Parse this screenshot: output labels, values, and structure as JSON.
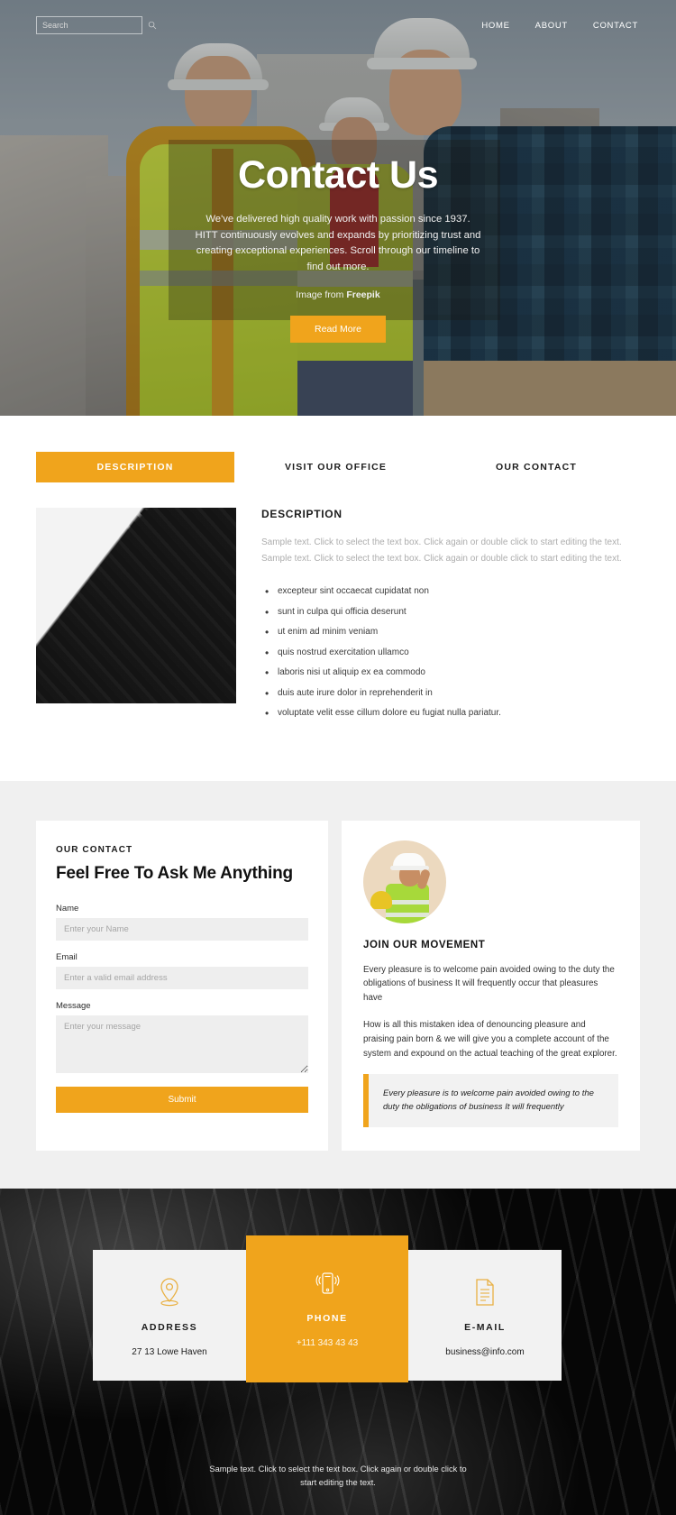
{
  "header": {
    "search": {
      "placeholder": "Search",
      "value": "",
      "icon": "search-icon"
    },
    "nav": [
      {
        "label": "HOME"
      },
      {
        "label": "ABOUT"
      },
      {
        "label": "CONTACT"
      }
    ]
  },
  "hero": {
    "title": "Contact Us",
    "description": "We've delivered high quality work with passion since 1937. HITT continuously evolves and expands by prioritizing trust and creating exceptional experiences. Scroll through our timeline to find out more.",
    "credit_prefix": "Image from ",
    "credit_source": "Freepik",
    "cta_label": "Read More"
  },
  "tabs": [
    {
      "label": "DESCRIPTION",
      "active": true
    },
    {
      "label": "VISIT OUR OFFICE",
      "active": false
    },
    {
      "label": "OUR CONTACT",
      "active": false
    }
  ],
  "description": {
    "heading": "DESCRIPTION",
    "paragraph": "Sample text. Click to select the text box. Click again or double click to start editing the text. Sample text. Click to select the text box. Click again or double click to start editing the text.",
    "bullets": [
      "excepteur sint occaecat cupidatat non",
      "sunt in culpa qui officia deserunt",
      "ut enim ad minim veniam",
      "quis nostrud exercitation ullamco",
      "laboris nisi ut aliquip ex ea commodo",
      "duis aute irure dolor in reprehenderit in",
      "voluptate velit esse cillum dolore eu fugiat nulla pariatur."
    ]
  },
  "contact_form": {
    "eyebrow": "OUR CONTACT",
    "title": "Feel Free To Ask Me Anything",
    "fields": [
      {
        "label": "Name",
        "placeholder": "Enter your Name",
        "value": ""
      },
      {
        "label": "Email",
        "placeholder": "Enter a valid email address",
        "value": ""
      },
      {
        "label": "Message",
        "placeholder": "Enter your message",
        "value": ""
      }
    ],
    "submit_label": "Submit"
  },
  "join": {
    "avatar": "construction-worker-avatar",
    "heading": "JOIN OUR MOVEMENT",
    "paragraph_1": "Every pleasure is to welcome pain avoided owing to the duty the obligations of business It will frequently occur that pleasures have",
    "paragraph_2": "How is all this mistaken idea of denouncing pleasure and praising pain born & we will give you a complete account of the system and expound on the actual teaching of the great explorer.",
    "quote": "Every pleasure is to welcome pain avoided owing to the duty the obligations of business It will frequently"
  },
  "footer": {
    "cards": [
      {
        "icon": "map-pin-icon",
        "title": "ADDRESS",
        "value": "27 13 Lowe Haven",
        "highlight": false
      },
      {
        "icon": "mobile-phone-icon",
        "title": "PHONE",
        "value": "+111 343 43 43",
        "highlight": true
      },
      {
        "icon": "document-icon",
        "title": "E-MAIL",
        "value": "business@info.com",
        "highlight": false
      }
    ],
    "note": "Sample text. Click to select the text box. Click again or double click to start editing the text."
  },
  "colors": {
    "accent": "#F0A41C",
    "dark": "#1C1C1C",
    "grey_bg": "#F0F0F0",
    "field_bg": "#EEEEEE",
    "footer_bg": "#060606"
  }
}
